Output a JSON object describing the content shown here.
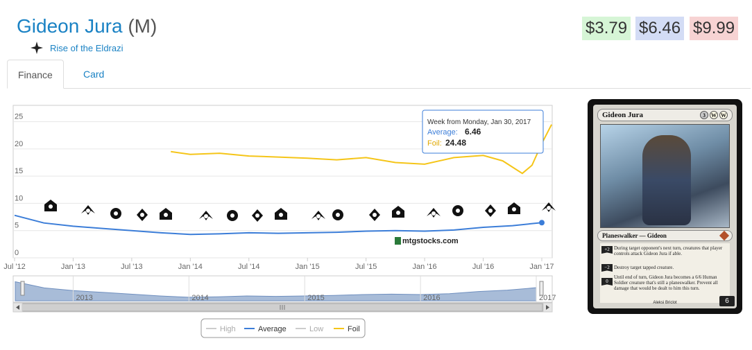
{
  "header": {
    "name": "Gideon Jura",
    "rarity": "(M)",
    "set_name": "Rise of the Eldrazi"
  },
  "prices": {
    "low": "$3.79",
    "avg": "$6.46",
    "foil": "$9.99"
  },
  "tabs": [
    {
      "label": "Finance"
    },
    {
      "label": "Card"
    }
  ],
  "chart_data": {
    "type": "line",
    "y_ticks": [
      "0",
      "5",
      "10",
      "15",
      "20",
      "25"
    ],
    "ylim": [
      0,
      28
    ],
    "x_ticks": [
      "Jul '12",
      "Jan '13",
      "Jul '13",
      "Jan '14",
      "Jul '14",
      "Jan '15",
      "Jul '15",
      "Jan '16",
      "Jul '16",
      "Jan '17"
    ],
    "navigator_labels": [
      "2013",
      "2014",
      "2015",
      "2016",
      "2017"
    ],
    "watermark": "mtgstocks.com",
    "tooltip": {
      "header": "Week from Monday, Jan 30, 2017",
      "avg_label": "Average:",
      "avg_value": "6.46",
      "foil_label": "Foil:",
      "foil_value": "24.48"
    },
    "legend": [
      {
        "name": "High",
        "color": "#cccccc"
      },
      {
        "name": "Average",
        "color": "#3b7dd8"
      },
      {
        "name": "Low",
        "color": "#cccccc"
      },
      {
        "name": "Foil",
        "color": "#f5c518"
      }
    ],
    "series": [
      {
        "name": "Average",
        "color": "#3b7dd8",
        "x": [
          "Jul '12",
          "Oct '12",
          "Jan '13",
          "Apr '13",
          "Jul '13",
          "Oct '13",
          "Jan '14",
          "Apr '14",
          "Jul '14",
          "Oct '14",
          "Jan '15",
          "Apr '15",
          "Jul '15",
          "Oct '15",
          "Jan '16",
          "Apr '16",
          "Jul '16",
          "Oct '16",
          "Jan '17"
        ],
        "values": [
          7.8,
          6.4,
          5.8,
          5.4,
          5.0,
          4.6,
          4.3,
          4.4,
          4.6,
          4.5,
          4.6,
          4.7,
          4.9,
          5.0,
          4.9,
          5.1,
          5.6,
          5.9,
          6.46
        ]
      },
      {
        "name": "Foil",
        "color": "#f5c518",
        "x": [
          "Nov '13",
          "Jan '14",
          "Apr '14",
          "Jul '14",
          "Oct '14",
          "Jan '15",
          "Apr '15",
          "Jul '15",
          "Oct '15",
          "Jan '16",
          "Apr '16",
          "Jul '16",
          "Sep '16",
          "Nov '16",
          "Dec '16",
          "Jan '17",
          "Feb '17"
        ],
        "values": [
          19.5,
          19.0,
          19.2,
          18.7,
          18.5,
          18.3,
          18.0,
          18.4,
          17.5,
          17.2,
          18.4,
          18.8,
          17.8,
          15.5,
          17.0,
          21.0,
          24.48
        ]
      }
    ]
  },
  "set_icons": [
    {
      "name": "set-icon-1"
    },
    {
      "name": "set-icon-2"
    },
    {
      "name": "set-icon-3"
    },
    {
      "name": "set-icon-m14"
    },
    {
      "name": "set-icon-5"
    },
    {
      "name": "set-icon-6"
    },
    {
      "name": "set-icon-7"
    },
    {
      "name": "set-icon-m15"
    },
    {
      "name": "set-icon-9"
    },
    {
      "name": "set-icon-10"
    },
    {
      "name": "set-icon-11"
    },
    {
      "name": "set-icon-12"
    },
    {
      "name": "set-icon-13"
    },
    {
      "name": "set-icon-14"
    },
    {
      "name": "set-icon-15"
    },
    {
      "name": "set-icon-16"
    },
    {
      "name": "set-icon-17"
    },
    {
      "name": "set-icon-18"
    }
  ],
  "card": {
    "name": "Gideon Jura",
    "cost": [
      "3",
      "W",
      "W"
    ],
    "type_line": "Planeswalker — Gideon",
    "abilities": [
      {
        "cost": "+2",
        "text": "During target opponent's next turn, creatures that player controls attack Gideon Jura if able."
      },
      {
        "cost": "−2",
        "text": "Destroy target tapped creature."
      },
      {
        "cost": "0",
        "text": "Until end of turn, Gideon Jura becomes a 6/6 Human Soldier creature that's still a planeswalker. Prevent all damage that would be dealt to him this turn."
      }
    ],
    "artist": "Aleksi Briclot",
    "loyalty": "6"
  }
}
